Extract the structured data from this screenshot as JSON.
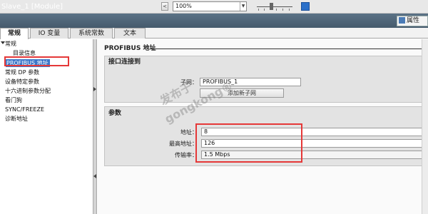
{
  "toolbar": {
    "nav_prev": "<",
    "nav_next": ">",
    "zoom_value": "100%",
    "zoom_dropdown_glyph": "▼"
  },
  "window": {
    "title": "Slave_1 [Module]",
    "properties_tab": "属性"
  },
  "tabs": [
    {
      "label": "常规",
      "active": true
    },
    {
      "label": "IO 变量",
      "active": false
    },
    {
      "label": "系统常数",
      "active": false
    },
    {
      "label": "文本",
      "active": false
    }
  ],
  "nav": {
    "items": [
      {
        "label": "常规"
      },
      {
        "label": "目录信息"
      },
      {
        "label": "PROFIBUS 地址",
        "selected": true
      },
      {
        "label": "常规 DP 参数"
      },
      {
        "label": "设备特定参数"
      },
      {
        "label": "十六进制参数分配"
      },
      {
        "label": "看门狗"
      },
      {
        "label": "SYNC/FREEZE"
      },
      {
        "label": "诊断地址"
      }
    ]
  },
  "main": {
    "heading": "PROFIBUS 地址",
    "interface": {
      "title": "接口连接到",
      "subnet_label": "子网：",
      "subnet_value": "PROFIBUS_1",
      "add_subnet_button": "添加新子网"
    },
    "params": {
      "title": "参数",
      "address_label": "地址：",
      "address_value": "8",
      "max_address_label": "最高地址：",
      "max_address_value": "126",
      "baud_label": "传输率：",
      "baud_value": "1.5 Mbps"
    }
  },
  "watermark": {
    "line1": "发布于",
    "line2": "gongkong®"
  },
  "colors": {
    "title_bar": "#4f6577",
    "selection": "#3d77c9",
    "highlight_box": "#e53838",
    "section_bg": "#e3e3e3"
  },
  "icons": [
    "triangle-expand-icon",
    "properties-icon",
    "navigator-icon",
    "splitter-arrow-icon"
  ]
}
